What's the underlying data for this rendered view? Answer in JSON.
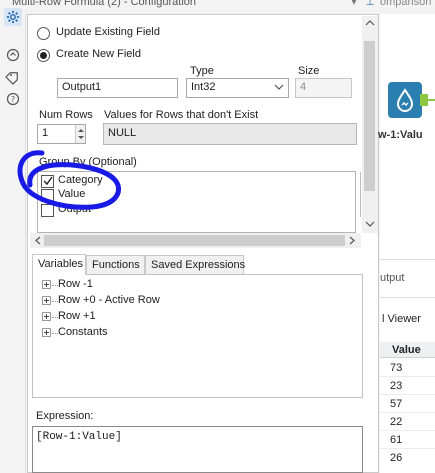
{
  "window": {
    "title": "Multi-Row Formula (2) - Configuration",
    "background_tab_label": "omparison"
  },
  "config": {
    "mode_options": [
      {
        "label": "Update Existing Field",
        "selected": false
      },
      {
        "label": "Create New  Field",
        "selected": true
      }
    ],
    "type_label": "Type",
    "size_label": "Size",
    "field_name_value": "Output1",
    "type_value": "Int32",
    "size_value": "4",
    "num_rows_label": "Num Rows",
    "num_rows_value": "1",
    "nonexist_label": "Values for Rows that don't Exist",
    "nonexist_value": "NULL",
    "group_by_label": "Group By (Optional)",
    "group_by_fields": [
      {
        "label": "Category",
        "checked": true
      },
      {
        "label": "Value",
        "checked": false
      },
      {
        "label": "Output",
        "checked": false
      }
    ]
  },
  "tabs": [
    {
      "label": "Variables",
      "active": true
    },
    {
      "label": "Functions",
      "active": false
    },
    {
      "label": "Saved Expressions",
      "active": false
    }
  ],
  "variables_tree": [
    "Row -1",
    "Row +0 - Active Row",
    "Row +1",
    "Constants"
  ],
  "expression": {
    "label": "Expression:",
    "value": "[Row-1:Value]"
  },
  "canvas": {
    "tool_label": "w-1:Valu",
    "accent_color": "#2b7fb0",
    "connector_color": "#8dc63f"
  },
  "results": {
    "header": "utput",
    "viewer_label": "l Viewer",
    "column_header": "Value",
    "values": [
      "73",
      "23",
      "57",
      "22",
      "61",
      "26"
    ]
  },
  "colors": {
    "annotation": "#1a1ae6",
    "rail_active": "#d6e6f7"
  }
}
